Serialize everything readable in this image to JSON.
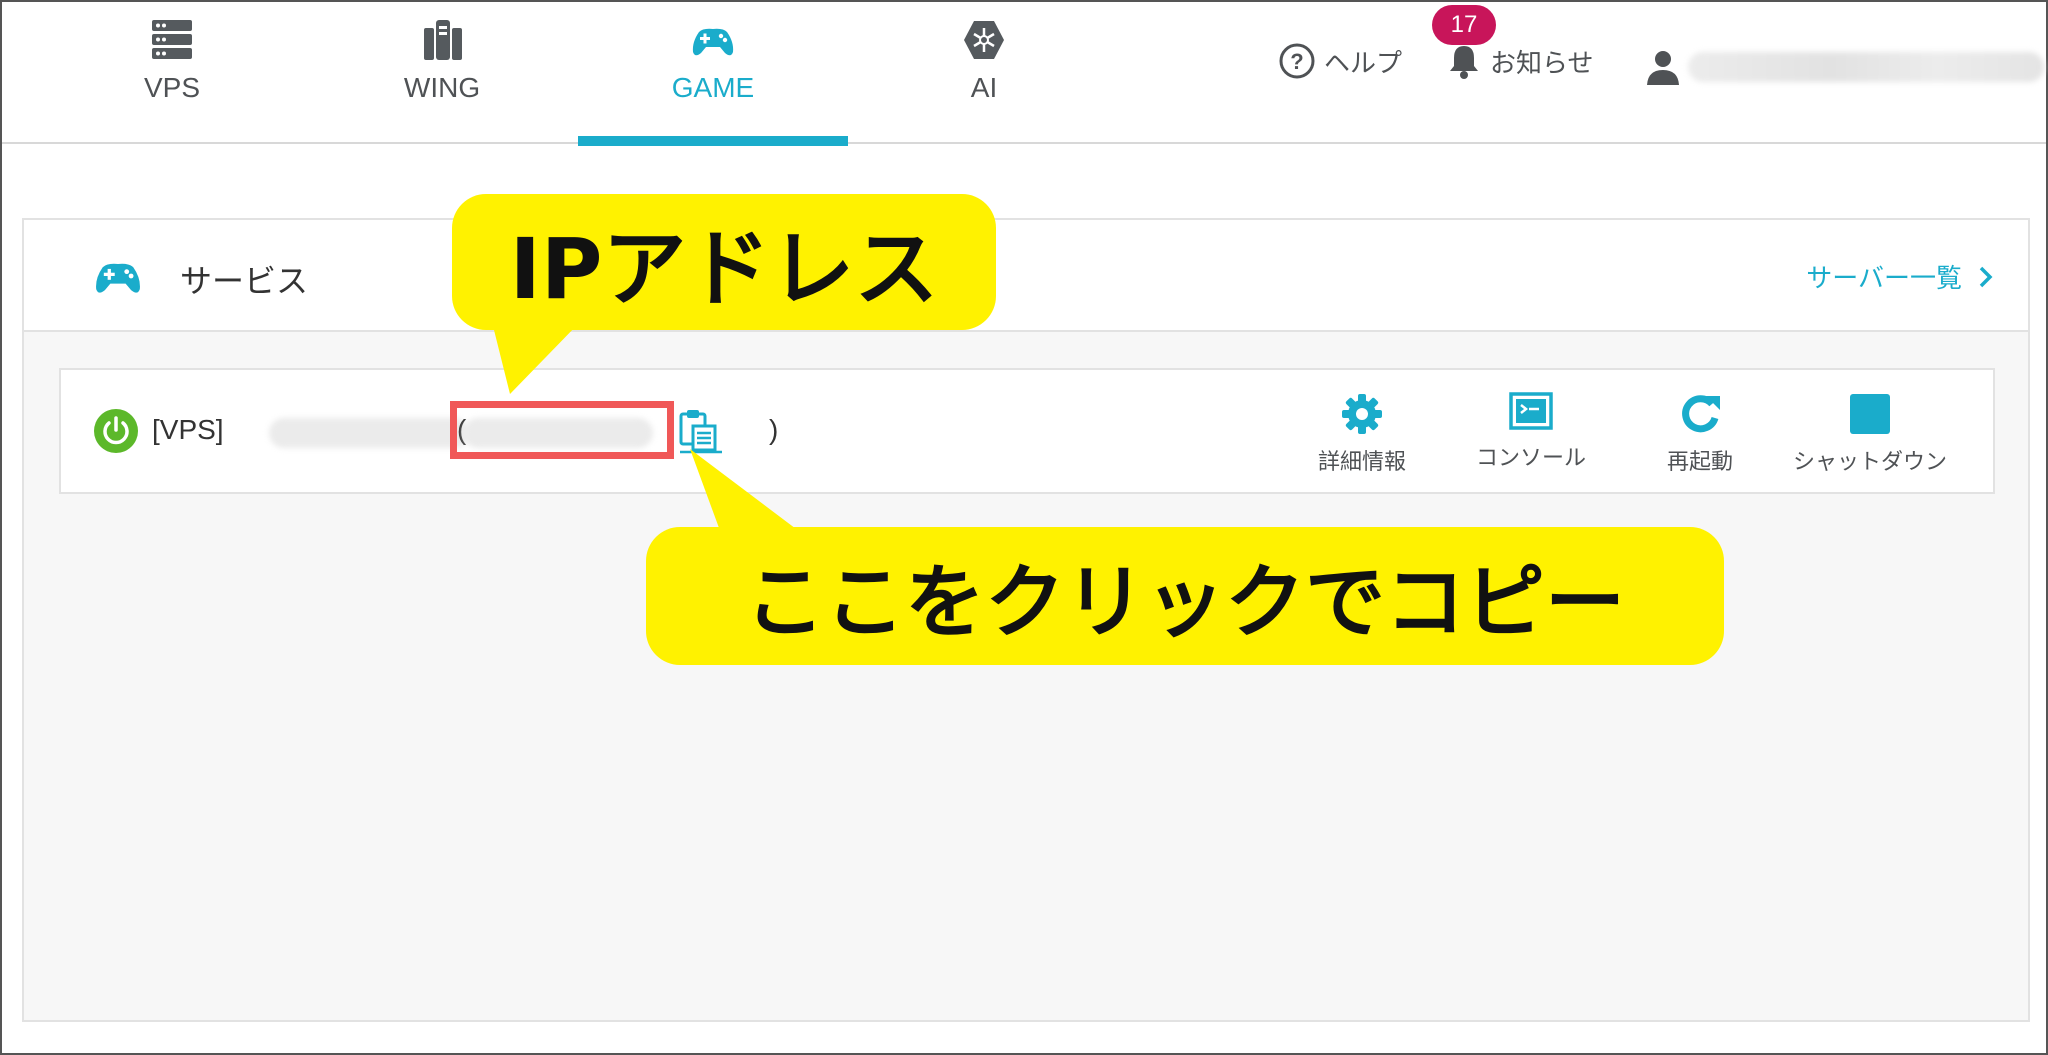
{
  "nav": {
    "tabs": [
      {
        "label": "VPS",
        "icon": "server-icon"
      },
      {
        "label": "WING",
        "icon": "wing-icon"
      },
      {
        "label": "GAME",
        "icon": "gamepad-icon",
        "active": true
      },
      {
        "label": "AI",
        "icon": "ai-icon"
      }
    ],
    "help_label": "ヘルプ",
    "notice_label": "お知らせ",
    "notice_count": "17"
  },
  "service": {
    "title": "サービス",
    "server_list_link": "サーバー一覧",
    "row": {
      "tag": "[VPS]",
      "paren_open": "(",
      "paren_close": ")",
      "status": "running"
    },
    "actions": [
      {
        "label": "詳細情報",
        "icon": "gear-icon"
      },
      {
        "label": "コンソール",
        "icon": "console-icon"
      },
      {
        "label": "再起動",
        "icon": "restart-icon"
      },
      {
        "label": "シャットダウン",
        "icon": "shutdown-icon"
      }
    ]
  },
  "annotations": {
    "ip_callout": "IPアドレス",
    "copy_callout": "ここをクリックでコピー"
  },
  "colors": {
    "accent": "#1aaccb",
    "badge": "#c8155a",
    "running": "#5cb82a",
    "callout": "#fff200",
    "highlight": "#f05858"
  }
}
